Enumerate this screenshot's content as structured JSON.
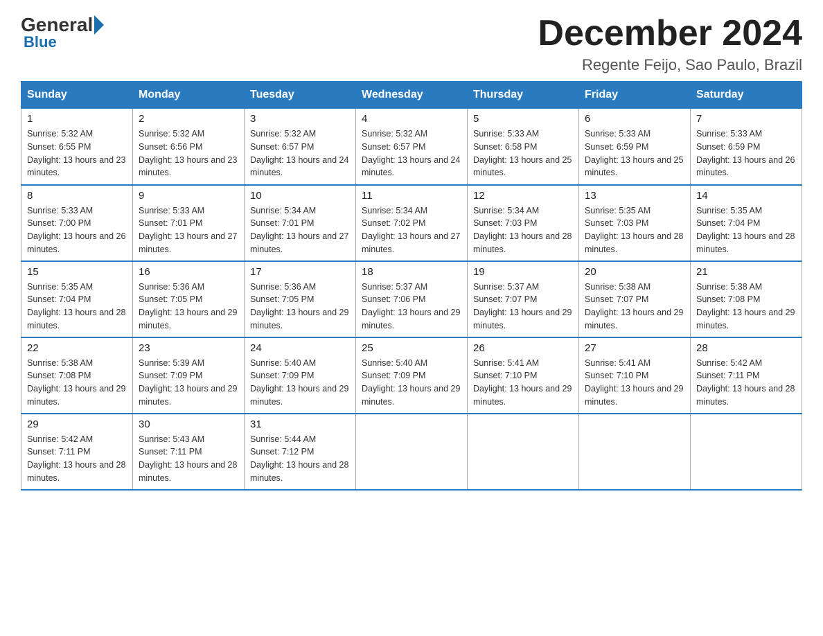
{
  "header": {
    "logo_general": "General",
    "logo_blue": "Blue",
    "month_title": "December 2024",
    "location": "Regente Feijo, Sao Paulo, Brazil"
  },
  "days_of_week": [
    "Sunday",
    "Monday",
    "Tuesday",
    "Wednesday",
    "Thursday",
    "Friday",
    "Saturday"
  ],
  "weeks": [
    [
      {
        "day": "1",
        "sunrise": "5:32 AM",
        "sunset": "6:55 PM",
        "daylight": "13 hours and 23 minutes."
      },
      {
        "day": "2",
        "sunrise": "5:32 AM",
        "sunset": "6:56 PM",
        "daylight": "13 hours and 23 minutes."
      },
      {
        "day": "3",
        "sunrise": "5:32 AM",
        "sunset": "6:57 PM",
        "daylight": "13 hours and 24 minutes."
      },
      {
        "day": "4",
        "sunrise": "5:32 AM",
        "sunset": "6:57 PM",
        "daylight": "13 hours and 24 minutes."
      },
      {
        "day": "5",
        "sunrise": "5:33 AM",
        "sunset": "6:58 PM",
        "daylight": "13 hours and 25 minutes."
      },
      {
        "day": "6",
        "sunrise": "5:33 AM",
        "sunset": "6:59 PM",
        "daylight": "13 hours and 25 minutes."
      },
      {
        "day": "7",
        "sunrise": "5:33 AM",
        "sunset": "6:59 PM",
        "daylight": "13 hours and 26 minutes."
      }
    ],
    [
      {
        "day": "8",
        "sunrise": "5:33 AM",
        "sunset": "7:00 PM",
        "daylight": "13 hours and 26 minutes."
      },
      {
        "day": "9",
        "sunrise": "5:33 AM",
        "sunset": "7:01 PM",
        "daylight": "13 hours and 27 minutes."
      },
      {
        "day": "10",
        "sunrise": "5:34 AM",
        "sunset": "7:01 PM",
        "daylight": "13 hours and 27 minutes."
      },
      {
        "day": "11",
        "sunrise": "5:34 AM",
        "sunset": "7:02 PM",
        "daylight": "13 hours and 27 minutes."
      },
      {
        "day": "12",
        "sunrise": "5:34 AM",
        "sunset": "7:03 PM",
        "daylight": "13 hours and 28 minutes."
      },
      {
        "day": "13",
        "sunrise": "5:35 AM",
        "sunset": "7:03 PM",
        "daylight": "13 hours and 28 minutes."
      },
      {
        "day": "14",
        "sunrise": "5:35 AM",
        "sunset": "7:04 PM",
        "daylight": "13 hours and 28 minutes."
      }
    ],
    [
      {
        "day": "15",
        "sunrise": "5:35 AM",
        "sunset": "7:04 PM",
        "daylight": "13 hours and 28 minutes."
      },
      {
        "day": "16",
        "sunrise": "5:36 AM",
        "sunset": "7:05 PM",
        "daylight": "13 hours and 29 minutes."
      },
      {
        "day": "17",
        "sunrise": "5:36 AM",
        "sunset": "7:05 PM",
        "daylight": "13 hours and 29 minutes."
      },
      {
        "day": "18",
        "sunrise": "5:37 AM",
        "sunset": "7:06 PM",
        "daylight": "13 hours and 29 minutes."
      },
      {
        "day": "19",
        "sunrise": "5:37 AM",
        "sunset": "7:07 PM",
        "daylight": "13 hours and 29 minutes."
      },
      {
        "day": "20",
        "sunrise": "5:38 AM",
        "sunset": "7:07 PM",
        "daylight": "13 hours and 29 minutes."
      },
      {
        "day": "21",
        "sunrise": "5:38 AM",
        "sunset": "7:08 PM",
        "daylight": "13 hours and 29 minutes."
      }
    ],
    [
      {
        "day": "22",
        "sunrise": "5:38 AM",
        "sunset": "7:08 PM",
        "daylight": "13 hours and 29 minutes."
      },
      {
        "day": "23",
        "sunrise": "5:39 AM",
        "sunset": "7:09 PM",
        "daylight": "13 hours and 29 minutes."
      },
      {
        "day": "24",
        "sunrise": "5:40 AM",
        "sunset": "7:09 PM",
        "daylight": "13 hours and 29 minutes."
      },
      {
        "day": "25",
        "sunrise": "5:40 AM",
        "sunset": "7:09 PM",
        "daylight": "13 hours and 29 minutes."
      },
      {
        "day": "26",
        "sunrise": "5:41 AM",
        "sunset": "7:10 PM",
        "daylight": "13 hours and 29 minutes."
      },
      {
        "day": "27",
        "sunrise": "5:41 AM",
        "sunset": "7:10 PM",
        "daylight": "13 hours and 29 minutes."
      },
      {
        "day": "28",
        "sunrise": "5:42 AM",
        "sunset": "7:11 PM",
        "daylight": "13 hours and 28 minutes."
      }
    ],
    [
      {
        "day": "29",
        "sunrise": "5:42 AM",
        "sunset": "7:11 PM",
        "daylight": "13 hours and 28 minutes."
      },
      {
        "day": "30",
        "sunrise": "5:43 AM",
        "sunset": "7:11 PM",
        "daylight": "13 hours and 28 minutes."
      },
      {
        "day": "31",
        "sunrise": "5:44 AM",
        "sunset": "7:12 PM",
        "daylight": "13 hours and 28 minutes."
      },
      null,
      null,
      null,
      null
    ]
  ],
  "labels": {
    "sunrise_prefix": "Sunrise: ",
    "sunset_prefix": "Sunset: ",
    "daylight_prefix": "Daylight: "
  }
}
